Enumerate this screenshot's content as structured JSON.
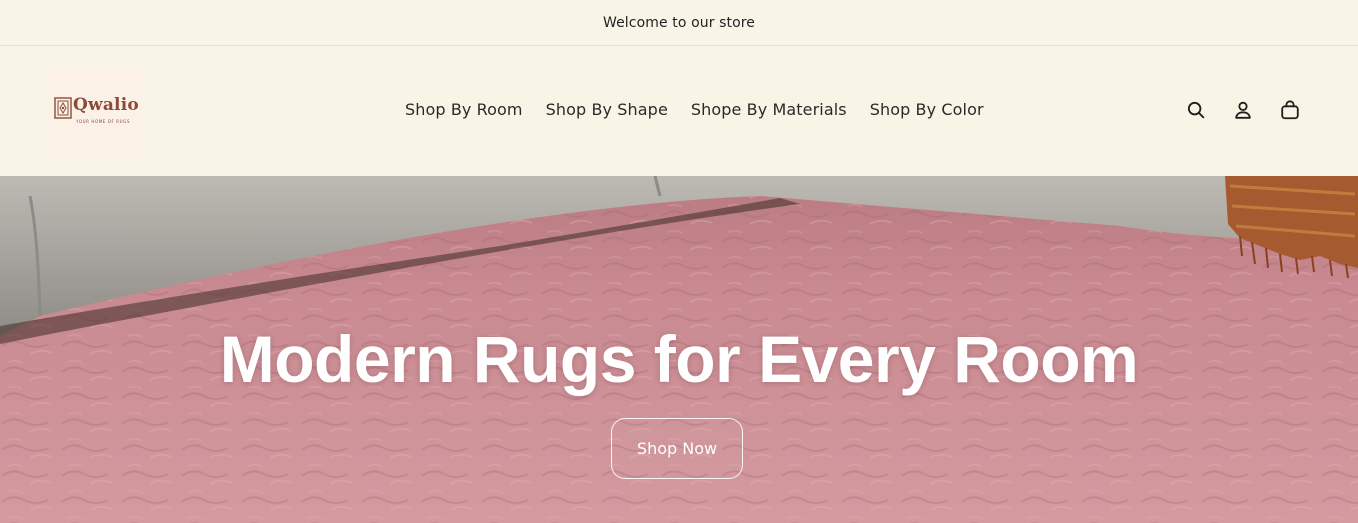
{
  "announcement": {
    "text": "Welcome to our store"
  },
  "logo": {
    "name": "Qwalio",
    "tagline": "YOUR HOME OF RUGS",
    "color": "#8b4a3a"
  },
  "nav": {
    "items": [
      {
        "label": "Shop By Room"
      },
      {
        "label": "Shop By Shape"
      },
      {
        "label": "Shope By Materials"
      },
      {
        "label": "Shop By Color"
      }
    ]
  },
  "header_icons": [
    "search-icon",
    "account-icon",
    "cart-icon"
  ],
  "hero": {
    "title": "Modern Rugs for Every Room",
    "cta_label": "Shop Now",
    "rug_color": "#c98a91",
    "sofa_color": "#c7c3bd"
  }
}
